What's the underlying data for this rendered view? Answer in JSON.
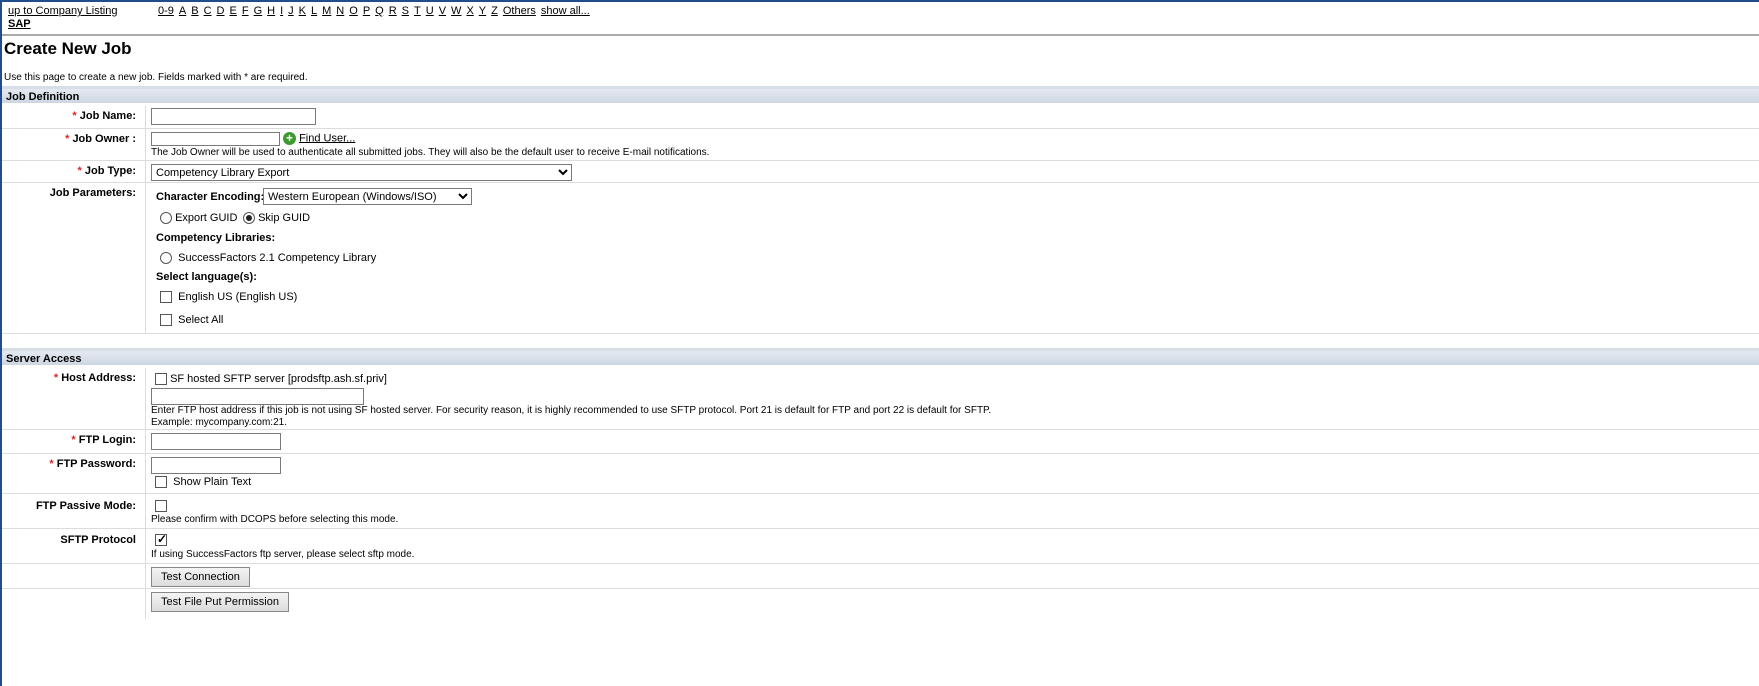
{
  "nav": {
    "up_link": "up to Company Listing",
    "company": "SAP",
    "letters": [
      "0-9",
      "A",
      "B",
      "C",
      "D",
      "E",
      "F",
      "G",
      "H",
      "I",
      "J",
      "K",
      "L",
      "M",
      "N",
      "O",
      "P",
      "Q",
      "R",
      "S",
      "T",
      "U",
      "V",
      "W",
      "X",
      "Y",
      "Z",
      "Others",
      "show all..."
    ]
  },
  "page": {
    "title": "Create New Job",
    "intro": "Use this page to create a new job. Fields marked with * are required."
  },
  "job_definition": {
    "heading": "Job Definition",
    "required_mark": "*",
    "job_name_label": "Job Name:",
    "job_name_value": "",
    "job_owner_label": "Job Owner :",
    "job_owner_value": "",
    "find_user": "Find User...",
    "job_owner_help": "The Job Owner will be used to authenticate all submitted jobs. They will also be the default user to receive E-mail notifications.",
    "job_type_label": "Job Type:",
    "job_type_value": "Competency Library Export",
    "params_label": "Job Parameters:",
    "encoding_label": "Character Encoding:",
    "encoding_value": "Western European (Windows/ISO)",
    "export_guid": "Export GUID",
    "skip_guid": "Skip GUID",
    "guid_selected": "Skip GUID",
    "competency_libraries_label": "Competency Libraries:",
    "library_option": "SuccessFactors 2.1 Competency Library",
    "select_languages_label": "Select language(s):",
    "language_option": "English US (English US)",
    "select_all": "Select All"
  },
  "server_access": {
    "heading": "Server Access",
    "host_label": "Host Address:",
    "sf_hosted": "SF hosted SFTP server [prodsftp.ash.sf.priv]",
    "sf_hosted_checked": false,
    "host_value": "",
    "host_help": "Enter FTP host address if this job is not using SF hosted server. For security reason, it is highly recommended to use SFTP protocol. Port 21 is default for FTP and port 22 is default for SFTP.",
    "host_example": "Example: mycompany.com:21.",
    "ftp_login_label": "FTP Login:",
    "ftp_login_value": "",
    "ftp_password_label": "FTP Password:",
    "ftp_password_value": "",
    "show_plain_text": "Show Plain Text",
    "passive_label": "FTP Passive Mode:",
    "passive_checked": false,
    "passive_help": "Please confirm with DCOPS before selecting this mode.",
    "sftp_label": "SFTP Protocol",
    "sftp_checked": true,
    "sftp_help": "If using SuccessFactors ftp server, please select sftp mode.",
    "test_connection": "Test Connection",
    "test_put": "Test File Put Permission"
  }
}
